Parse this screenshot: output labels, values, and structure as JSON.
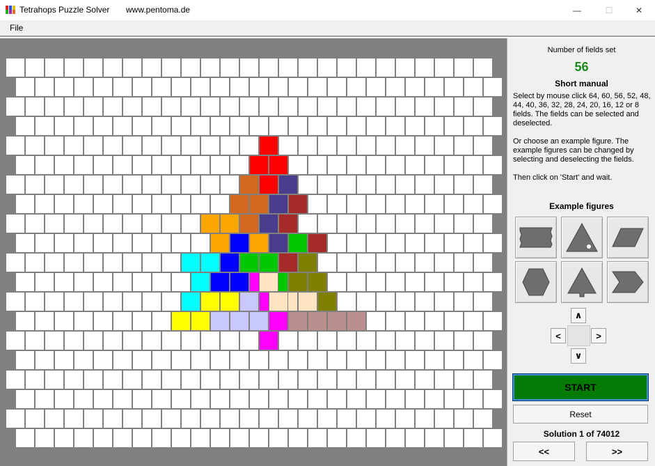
{
  "window": {
    "title": "Tetrahops Puzzle Solver",
    "website": "www.pentoma.de",
    "controls": {
      "minimize": "—",
      "maximize": "☐",
      "close": "✕"
    }
  },
  "menu": {
    "file": "File"
  },
  "panel": {
    "fields_label": "Number of fields set",
    "fields_count": "56",
    "manual_title": "Short manual",
    "manual_p1": "Select by mouse click 64, 60, 56, 52, 48, 44, 40, 36, 32, 28, 24, 20, 16, 12 or 8 fields. The fields can be selected and deselected.",
    "manual_p2": "Or choose an example figure. The example figures can be changed by selecting and deselecting the fields.",
    "manual_p3": "Then click on 'Start' and wait.",
    "examples_title": "Example figures",
    "examples": [
      {
        "icon": "rectangle-figure-icon"
      },
      {
        "icon": "triangle-figure-icon"
      },
      {
        "icon": "parallelogram-figure-icon"
      },
      {
        "icon": "hexagon-figure-icon"
      },
      {
        "icon": "tree-figure-icon"
      },
      {
        "icon": "arrow-figure-icon"
      }
    ],
    "arrows": {
      "up": "∧",
      "down": "∨",
      "left": "<",
      "right": ">"
    },
    "start_label": "START",
    "reset_label": "Reset",
    "solution_label": "Solution",
    "solution_current": "1",
    "solution_of": "of",
    "solution_total": "74012",
    "prev_label": "<<",
    "next_label": ">>"
  },
  "colors": {
    "board_background": "#808080",
    "empty_cell": "#ffffff",
    "fields_count": "#1a8a1a",
    "start_button": "#057a05"
  },
  "board": {
    "columns": 25,
    "rows": 20,
    "odd_rows_shifted": true,
    "pieces": [
      {
        "color": "#ff0000",
        "cells": [
          [
            4,
            13
          ],
          [
            5,
            12
          ],
          [
            5,
            13
          ],
          [
            6,
            13
          ]
        ]
      },
      {
        "color": "#d2691e",
        "cells": [
          [
            6,
            12
          ],
          [
            7,
            11
          ],
          [
            7,
            12
          ],
          [
            8,
            12
          ]
        ]
      },
      {
        "color": "#483d8b",
        "cells": [
          [
            6,
            14
          ],
          [
            7,
            13
          ],
          [
            8,
            13
          ],
          [
            9,
            13
          ]
        ]
      },
      {
        "color": "#a52a2a",
        "cells": [
          [
            7,
            14
          ],
          [
            8,
            14
          ],
          [
            9,
            15
          ],
          [
            10,
            14
          ]
        ]
      },
      {
        "color": "#ffa500",
        "cells": [
          [
            8,
            11
          ],
          [
            8,
            10
          ],
          [
            9,
            10
          ],
          [
            9,
            12
          ]
        ]
      },
      {
        "color": "#0000ff",
        "cells": [
          [
            9,
            11
          ],
          [
            10,
            11
          ],
          [
            11,
            10
          ],
          [
            11,
            11
          ]
        ]
      },
      {
        "color": "#00c800",
        "cells": [
          [
            9,
            14
          ],
          [
            10,
            12
          ],
          [
            10,
            13
          ],
          [
            11,
            13
          ]
        ]
      },
      {
        "color": "#808000",
        "cells": [
          [
            10,
            15
          ],
          [
            11,
            14
          ],
          [
            11,
            15
          ],
          [
            12,
            16
          ]
        ]
      },
      {
        "color": "#00ffff",
        "cells": [
          [
            10,
            9
          ],
          [
            10,
            10
          ],
          [
            11,
            9
          ],
          [
            12,
            9
          ]
        ]
      },
      {
        "color": "#ff00ff",
        "cells": [
          [
            11,
            12
          ],
          [
            12,
            13
          ],
          [
            13,
            13
          ],
          [
            14,
            13
          ]
        ]
      },
      {
        "color": "#ffe4c4",
        "cells": [
          [
            11,
            12.5
          ],
          [
            12,
            14
          ],
          [
            12,
            15
          ],
          [
            12,
            13.5
          ]
        ]
      },
      {
        "color": "#ffff00",
        "cells": [
          [
            12,
            10
          ],
          [
            12,
            11
          ],
          [
            13,
            8
          ],
          [
            13,
            9
          ]
        ]
      },
      {
        "color": "#c8c8ff",
        "cells": [
          [
            12,
            12
          ],
          [
            13,
            10
          ],
          [
            13,
            11
          ],
          [
            13,
            12
          ]
        ]
      },
      {
        "color": "#bc8f8f",
        "cells": [
          [
            13,
            14
          ],
          [
            13,
            15
          ],
          [
            13,
            16
          ],
          [
            13,
            17
          ]
        ]
      }
    ]
  }
}
